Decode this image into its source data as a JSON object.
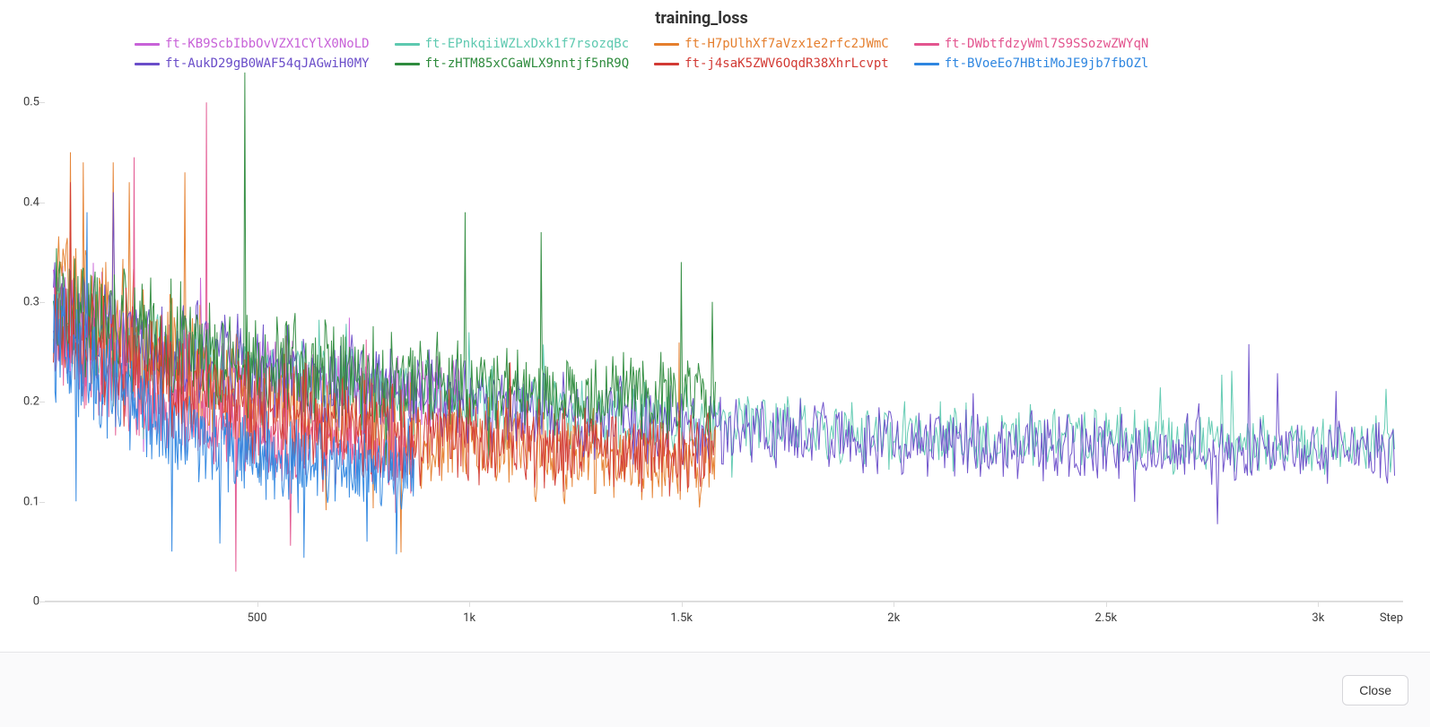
{
  "chart_data": {
    "type": "line",
    "title": "training_loss",
    "xlabel": "Step",
    "ylabel": "",
    "xlim": [
      0,
      3200
    ],
    "ylim": [
      0,
      0.52
    ],
    "x_ticks": [
      500,
      1000,
      1500,
      2000,
      2500,
      3000
    ],
    "x_tick_labels": [
      "500",
      "1k",
      "1.5k",
      "2k",
      "2.5k",
      "3k"
    ],
    "y_ticks": [
      0,
      0.1,
      0.2,
      0.3,
      0.4,
      0.5
    ],
    "series": [
      {
        "name": "ft-KB9ScbIbbOvVZX1CYlX0NoLD",
        "color": "#c862d8",
        "x_range": [
          20,
          980
        ],
        "start": 0.3,
        "end": 0.2,
        "noise": 0.055,
        "n": 480,
        "spikes": []
      },
      {
        "name": "ft-EPnkqiiWZLxDxk1f7rsozqBc",
        "color": "#5ec9b0",
        "x_range": [
          20,
          3180
        ],
        "start": 0.27,
        "end": 0.15,
        "noise": 0.045,
        "n": 940,
        "spikes": []
      },
      {
        "name": "ft-H7pUlhXf7aVzx1e2rfc2JWmC",
        "color": "#e57f2e",
        "x_range": [
          20,
          1580
        ],
        "start": 0.32,
        "end": 0.13,
        "noise": 0.065,
        "n": 620,
        "spikes": [
          [
            60,
            0.45
          ],
          [
            90,
            0.44
          ],
          [
            160,
            0.44
          ],
          [
            200,
            0.42
          ],
          [
            330,
            0.43
          ]
        ]
      },
      {
        "name": "ft-DWbtfdzyWml7S9SSozwZWYqN",
        "color": "#e3558f",
        "x_range": [
          20,
          870
        ],
        "start": 0.28,
        "end": 0.14,
        "noise": 0.055,
        "n": 430,
        "spikes": [
          [
            210,
            0.445
          ],
          [
            380,
            0.5
          ],
          [
            450,
            0.03
          ]
        ]
      },
      {
        "name": "ft-AukD29gB0WAF54qJAGwiH0MY",
        "color": "#6a4dc9",
        "x_range": [
          20,
          3180
        ],
        "start": 0.29,
        "end": 0.14,
        "noise": 0.048,
        "n": 940,
        "spikes": [
          [
            160,
            0.41
          ]
        ]
      },
      {
        "name": "ft-zHTM85xCGaWLX9nntjf5nR9Q",
        "color": "#2e8b3d",
        "x_range": [
          20,
          1580
        ],
        "start": 0.3,
        "end": 0.2,
        "noise": 0.06,
        "n": 620,
        "spikes": [
          [
            470,
            0.53
          ],
          [
            990,
            0.39
          ],
          [
            1170,
            0.37
          ],
          [
            1500,
            0.34
          ]
        ]
      },
      {
        "name": "ft-j4saK5ZWV6OqdR38XhrLcvpt",
        "color": "#d23a34",
        "x_range": [
          20,
          1580
        ],
        "start": 0.28,
        "end": 0.14,
        "noise": 0.06,
        "n": 620,
        "spikes": [
          [
            60,
            0.42
          ]
        ]
      },
      {
        "name": "ft-BVoeEo7HBtiMoJE9jb7fbOZl",
        "color": "#2e86e0",
        "x_range": [
          20,
          870
        ],
        "start": 0.27,
        "end": 0.12,
        "noise": 0.055,
        "n": 430,
        "spikes": [
          [
            100,
            0.39
          ],
          [
            300,
            0.05
          ],
          [
            760,
            0.06
          ]
        ]
      }
    ]
  },
  "footer": {
    "close_label": "Close"
  }
}
